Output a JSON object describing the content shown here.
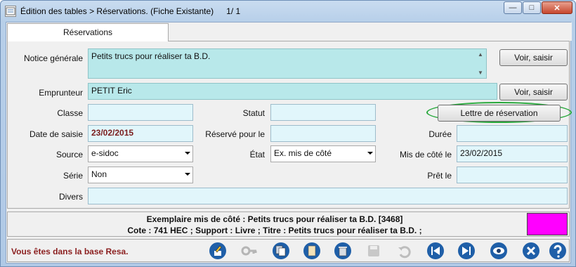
{
  "window": {
    "title": "Édition des tables > Réservations.  (Fiche Existante)",
    "record_position": "1/   1",
    "minimize_glyph": "—",
    "maximize_glyph": "□",
    "close_glyph": "✕"
  },
  "tabs": [
    {
      "label": "Réservations"
    }
  ],
  "form": {
    "notice_label": "Notice générale",
    "notice_value": "Petits trucs pour réaliser ta B.D.",
    "notice_button": "Voir, saisir",
    "borrower_label": "Emprunteur",
    "borrower_value": "PETIT Eric",
    "borrower_button": "Voir, saisir",
    "class_label": "Classe",
    "class_value": "",
    "status_label": "Statut",
    "status_value": "",
    "letter_button": "Lettre de réservation",
    "entry_date_label": "Date de saisie",
    "entry_date_value": "23/02/2015",
    "reserved_for_label": "Réservé pour le",
    "reserved_for_value": "",
    "duration_label": "Durée",
    "duration_value": "",
    "source_label": "Source",
    "source_value": "e-sidoc",
    "state_label": "État",
    "state_value": "Ex. mis de côté",
    "set_aside_label": "Mis de côté le",
    "set_aside_value": "23/02/2015",
    "series_label": "Série",
    "series_value": "Non",
    "loaned_label": "Prêt le",
    "loaned_value": "",
    "misc_label": "Divers",
    "misc_value": ""
  },
  "info": {
    "line1": "Exemplaire mis de côté : Petits trucs pour réaliser ta B.D. [3468]",
    "line2": "Cote  : 741 HEC ;  Support  : Livre ;  Titre  : Petits trucs pour réaliser ta B.D. ;",
    "swatch_color": "#ff00ff"
  },
  "status_bar": {
    "message": "Vous êtes dans la base Resa."
  },
  "toolbar_icons": [
    "edit-icon",
    "key-icon",
    "copy-icon",
    "note-icon",
    "trash-icon",
    "save-icon",
    "undo-icon",
    "first-record-icon",
    "last-record-icon",
    "view-icon",
    "close-icon",
    "help-icon"
  ],
  "colors": {
    "field_light": "#e1f6fb",
    "field_teal": "#b8e8ea",
    "highlight_oval": "#27a83b",
    "status_text": "#8b1f1f"
  }
}
